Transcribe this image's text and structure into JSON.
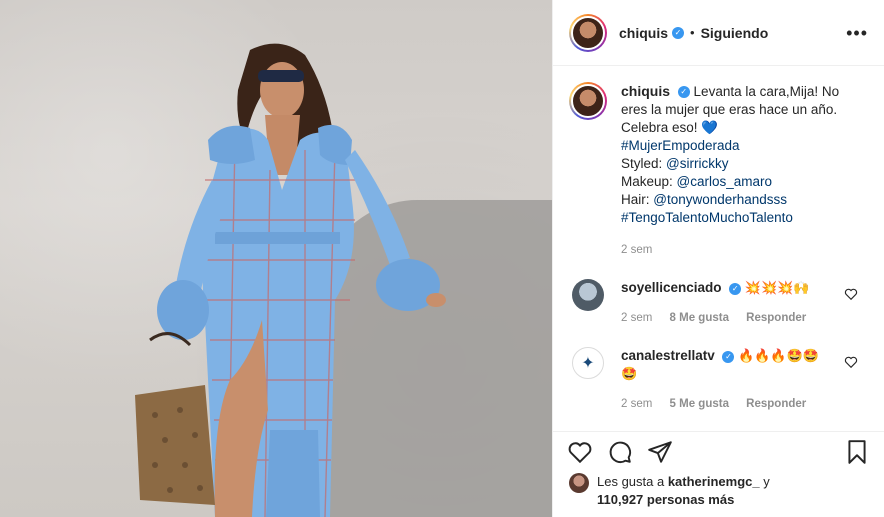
{
  "post": {
    "username": "chiquis",
    "follow_state": "Siguiendo",
    "separator": "•",
    "more_label": "•••"
  },
  "caption": {
    "username": "chiquis",
    "lines": [
      "Levanta la cara,Mija! No",
      "eres la mujer que eras hace un año.",
      "Celebra eso! 💙"
    ],
    "hashtag1": "#MujerEmpoderada",
    "styled_label": "Styled: ",
    "styled_handle": "@sirrickky",
    "makeup_label": "Makeup: ",
    "makeup_handle": "@carlos_amaro",
    "hair_label": "Hair: ",
    "hair_handle": "@tonywonderhandsss",
    "hashtag2": "#TengoTalentoMuchoTalento",
    "time": "2 sem"
  },
  "comments": [
    {
      "username": "soyellicenciado",
      "text": "💥💥💥🙌",
      "time": "2 sem",
      "likes": "8 Me gusta",
      "reply": "Responder"
    },
    {
      "username": "canalestrellatv",
      "text": "🔥🔥🔥🤩🤩",
      "text2": "🤩",
      "time": "2 sem",
      "likes": "5 Me gusta",
      "reply": "Responder"
    }
  ],
  "likes_bar": {
    "prefix": "Les gusta a ",
    "user": "katherinemgc_",
    "connector": " y",
    "count": "110,927 personas más"
  },
  "colors": {
    "verified": "#3897f0",
    "link": "#00376b",
    "muted": "#8e8e8e",
    "coat": "#7fb2e5"
  }
}
